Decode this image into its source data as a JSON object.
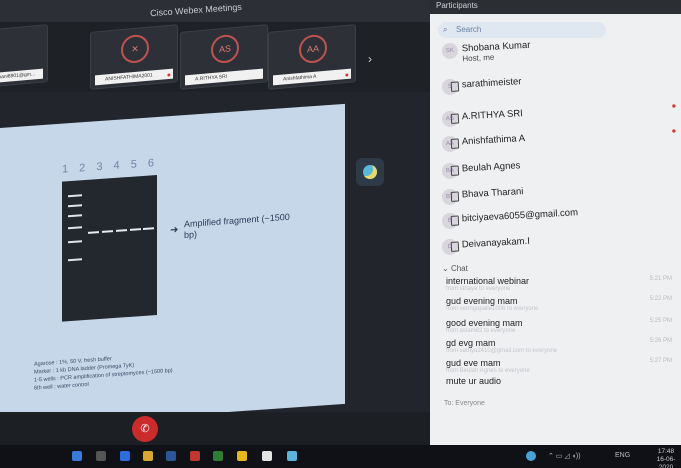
{
  "window": {
    "title": "Cisco Webex Meetings"
  },
  "video_strip": {
    "tiles": [
      {
        "initials": "",
        "name": "balasubramani8901@gm..."
      },
      {
        "initials": "",
        "name": "ANISHFATHIMA2001"
      },
      {
        "initials": "AS",
        "name": "A.RITHYA SRI"
      },
      {
        "initials": "AA",
        "name": "Anishfathima A"
      }
    ],
    "next_icon": "chevron-right-icon"
  },
  "slide": {
    "lane_numbers": "1 2 3 4 5 6",
    "fragment_label": "Amplified fragment (~1500 bp)",
    "legend": [
      "Agarose : 1%, 50 V, fresh buffer",
      "Marker : 1 kb DNA ladder (Promega TyK)",
      "1-5 wells : PCR amplification of streptomyces (~1500 bp)",
      "6th well : water control"
    ]
  },
  "panel": {
    "header": "Participants",
    "search_placeholder": "Search",
    "participants": [
      {
        "initials": "SK",
        "name": "Shobana Kumar",
        "sub": "Host, me"
      },
      {
        "initials": "S",
        "name": "sarathimeister",
        "sub": ""
      },
      {
        "initials": "AS",
        "name": "A.RITHYA SRI",
        "sub": ""
      },
      {
        "initials": "AA",
        "name": "Anishfathima A",
        "sub": ""
      },
      {
        "initials": "BA",
        "name": "Beulah Agnes",
        "sub": ""
      },
      {
        "initials": "BT",
        "name": "Bhava Tharani",
        "sub": ""
      },
      {
        "initials": "B",
        "name": "bitciyaeva6055@gmail.com",
        "sub": ""
      },
      {
        "initials": "D",
        "name": "Deivanayakam.I",
        "sub": ""
      }
    ],
    "chat_header": "Chat",
    "chat": [
      {
        "text": "international webinar",
        "from": "from sthaya to everyone",
        "time": "5:21 PM"
      },
      {
        "text": "gud evening mam",
        "from": "from venngopalle1006 to everyone",
        "time": "5:22 PM"
      },
      {
        "text": "good evening mam",
        "from": "from aslam82 to everyone",
        "time": "5:25 PM"
      },
      {
        "text": "gd evg mam",
        "from": "from sathya2410@gmail.com to everyone",
        "time": "5:26 PM"
      },
      {
        "text": "gud eve mam",
        "from": "from Beulah Agnes to everyone",
        "time": "5:27 PM"
      },
      {
        "text": "mute ur audio",
        "from": "",
        "time": ""
      }
    ],
    "chat_to_label": "To: Everyone"
  },
  "taskbar": {
    "language": "ENG",
    "time": "17:48",
    "date": "16-06-2020",
    "colors": {
      "accent": "#2b88d8",
      "red": "#cc2b2b"
    }
  }
}
